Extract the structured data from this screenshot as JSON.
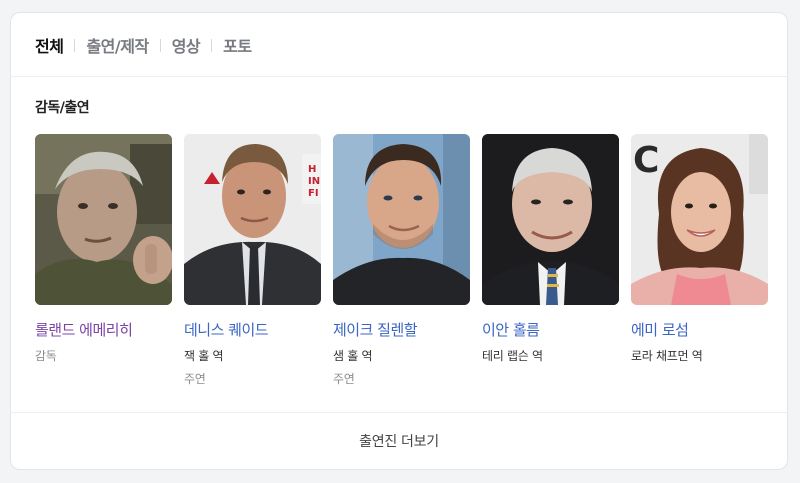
{
  "tabs": [
    {
      "label": "전체",
      "active": true
    },
    {
      "label": "출연/제작",
      "active": false
    },
    {
      "label": "영상",
      "active": false
    },
    {
      "label": "포토",
      "active": false
    }
  ],
  "section": {
    "title": "감독/출연"
  },
  "people": [
    {
      "name": "롤랜드 에메리히",
      "role": "감독",
      "sub": "",
      "visited": true
    },
    {
      "name": "데니스 퀘이드",
      "role": "잭 홀 역",
      "sub": "주연",
      "visited": false
    },
    {
      "name": "제이크 질렌할",
      "role": "샘 홀 역",
      "sub": "주연",
      "visited": false
    },
    {
      "name": "이안 홀름",
      "role": "테리 랩슨 역",
      "sub": "",
      "visited": false
    },
    {
      "name": "에미 로섬",
      "role": "로라 채프먼 역",
      "sub": "",
      "visited": false
    }
  ],
  "more": {
    "label": "출연진 더보기"
  },
  "colors": {
    "link": "#3b66c4",
    "visited_link": "#7b44a7",
    "active_tab": "#111111",
    "inactive_tab": "#777b80"
  }
}
